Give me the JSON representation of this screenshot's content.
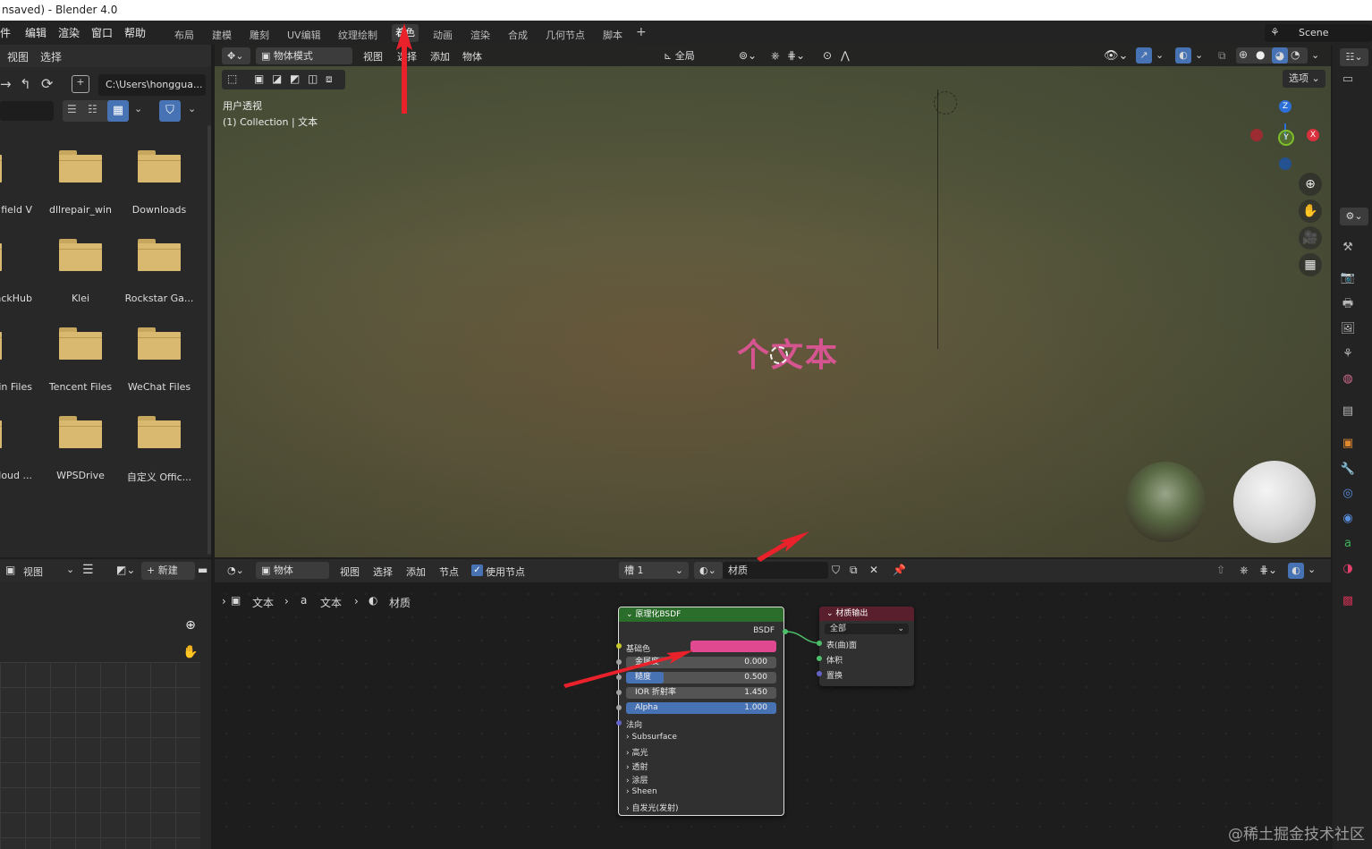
{
  "window": {
    "title": "nsaved) - Blender 4.0"
  },
  "menu": [
    "件",
    "编辑",
    "渲染",
    "窗口",
    "帮助"
  ],
  "workspaces": [
    "布局",
    "建模",
    "雕刻",
    "UV编辑",
    "纹理绘制",
    "着色",
    "动画",
    "渲染",
    "合成",
    "几何节点",
    "脚本"
  ],
  "active_workspace": "着色",
  "add_tab": "+",
  "scene": "Scene",
  "file_browser": {
    "menu": [
      "视图",
      "选择"
    ],
    "path": "C:\\Users\\honggua...",
    "folders": [
      [
        "field V",
        "dllrepair_win",
        "Downloads"
      ],
      [
        "ackHub",
        "Klei",
        "Rockstar Ga..."
      ],
      [
        "gin Files",
        "Tencent Files",
        "WeChat Files"
      ],
      [
        "Cloud ...",
        "WPSDrive",
        "自定义 Offic..."
      ]
    ]
  },
  "viewport": {
    "mode": "物体模式",
    "menu": [
      "视图",
      "选择",
      "添加",
      "物体"
    ],
    "transform_orientation": "全局",
    "options": "选项",
    "view_name": "用户透视",
    "collection": "(1) Collection | 文本",
    "text_object": "个文本",
    "gizmo": {
      "z": "Z",
      "y": "Y",
      "x": "X"
    }
  },
  "image_editor": {
    "view": "视图",
    "new": "新建"
  },
  "node_editor": {
    "type": "物体",
    "menu": [
      "视图",
      "选择",
      "添加",
      "节点"
    ],
    "use_nodes": "使用节点",
    "slot": "槽 1",
    "material": "材质",
    "breadcrumb": [
      "文本",
      "文本",
      "材质"
    ],
    "bsdf": {
      "title": "原理化BSDF",
      "output": "BSDF",
      "base_color_label": "基础色",
      "base_color": "#e0488f",
      "metallic": {
        "label": "金属度",
        "value": "0.000"
      },
      "roughness": {
        "label": "糙度",
        "value": "0.500",
        "fraction": 0.5
      },
      "ior": {
        "label": "IOR 折射率",
        "value": "1.450"
      },
      "alpha": {
        "label": "Alpha",
        "value": "1.000",
        "fraction": 1.0
      },
      "normal": "法向",
      "panels": [
        "Subsurface",
        "高光",
        "透射",
        "涂层",
        "Sheen",
        "自发光(发射)"
      ]
    },
    "output": {
      "title": "材质输出",
      "target": "全部",
      "sockets": [
        "表(曲)面",
        "体积",
        "置换"
      ]
    }
  },
  "watermark": "@稀土掘金技术社区",
  "colors": {
    "accent": "#4772b3",
    "annotation": "#e8212b",
    "text_pink": "#d65591"
  }
}
